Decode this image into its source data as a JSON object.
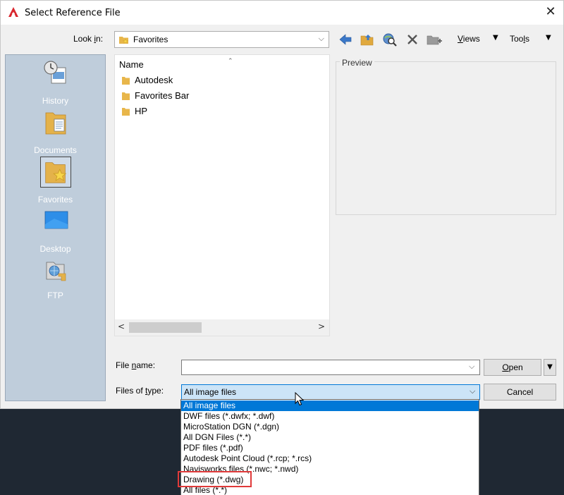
{
  "window": {
    "title": "Select Reference File",
    "close_glyph": "✕"
  },
  "lookin": {
    "label_pre": "Look ",
    "label_key": "i",
    "label_post": "n:",
    "value": "Favorites"
  },
  "toolbar": {
    "icons": [
      "back-icon",
      "up-folder-icon",
      "search-web-icon",
      "delete-icon",
      "create-folder-icon"
    ],
    "views_key": "V",
    "views_rest": "iews",
    "tools_pre": "Too",
    "tools_key": "l",
    "tools_post": "s"
  },
  "places": [
    {
      "label": "History",
      "icon": "history-icon"
    },
    {
      "label": "Documents",
      "icon": "documents-icon"
    },
    {
      "label": "Favorites",
      "icon": "favorites-icon",
      "selected": true
    },
    {
      "label": "Desktop",
      "icon": "desktop-icon"
    },
    {
      "label": "FTP",
      "icon": "ftp-icon"
    }
  ],
  "filelist": {
    "column_name": "Name",
    "items": [
      "Autodesk",
      "Favorites Bar",
      "HP"
    ]
  },
  "preview": {
    "label": "Preview"
  },
  "filename": {
    "label_pre": "File ",
    "label_key": "n",
    "label_post": "ame:",
    "value": ""
  },
  "filetype": {
    "label_pre": "Files of ",
    "label_key": "t",
    "label_post": "ype:",
    "value": "All image files",
    "options": [
      "All image files",
      "DWF files (*.dwfx; *.dwf)",
      "MicroStation DGN (*.dgn)",
      "All DGN Files (*.*)",
      "PDF files (*.pdf)",
      "Autodesk Point Cloud (*.rcp; *.rcs)",
      "Navisworks files (*.nwc; *.nwd)",
      "Drawing (*.dwg)",
      "All files (*.*)"
    ]
  },
  "buttons": {
    "open_key": "O",
    "open_rest": "pen",
    "cancel": "Cancel",
    "open_dropdown_glyph": "▼"
  },
  "colors": {
    "accent": "#0078d7",
    "places_bg": "#bfcddb",
    "highlight_box": "#e03a3a"
  }
}
